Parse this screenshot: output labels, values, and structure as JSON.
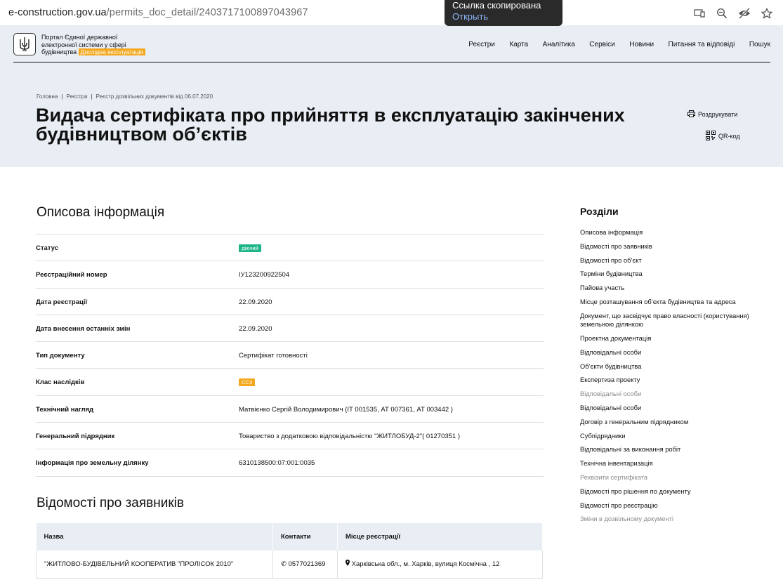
{
  "browser": {
    "url_domain": "e-construction.gov.ua",
    "url_path": "/permits_doc_detail/2403717100897043967",
    "toast_title": "Ссылка скопирована",
    "toast_action": "Открыть"
  },
  "header": {
    "logo_line1": "Портал Єдиної державної",
    "logo_line2": "електронної системи у сфері",
    "logo_line3": "будівництва",
    "logo_badge": "Дослідна експлуатація",
    "nav": [
      "Реєстри",
      "Карта",
      "Аналітика",
      "Сервіси",
      "Новини",
      "Питання та відповіді",
      "Пошук"
    ]
  },
  "breadcrumb": [
    "Головна",
    "Реєстри",
    "Реєстр дозвільних документів від 06.07.2020"
  ],
  "page_title": "Видача сертифіката про прийняття в експлуатацію закінчених будівництвом об’єктів",
  "actions": {
    "print": "Роздрукувати",
    "qr": "QR-код"
  },
  "section1_title": "Описова інформація",
  "info": [
    {
      "label": "Статус",
      "value": "діючий",
      "tag": "green"
    },
    {
      "label": "Реєстраційний номер",
      "value": "ІУ123200922504"
    },
    {
      "label": "Дата реєстрації",
      "value": "22.09.2020"
    },
    {
      "label": "Дата внесення останніх змін",
      "value": "22.09.2020"
    },
    {
      "label": "Тип документу",
      "value": "Сертифікат готовності"
    },
    {
      "label": "Клас наслідків",
      "value": "СС3",
      "tag": "orange"
    },
    {
      "label": "Технічний нагляд",
      "value": "Матвієнко Сергій Володимирович (ІТ 001535, АТ 007361, АТ 003442 )"
    },
    {
      "label": "Генеральний підрядник",
      "value": "Товариство з додатковою відповідальністю \"ЖИТЛОБУД-2\"( 01270351 )"
    },
    {
      "label": "Інформація про земельну ділянку",
      "value": "6310138500:07:001:0035"
    }
  ],
  "section2_title": "Відомості про заявників",
  "applicants": {
    "headers": [
      "Назва",
      "Контакти",
      "Місце реєстрації"
    ],
    "rows": [
      {
        "name": "\"ЖИТЛОВО-БУДІВЕЛЬНИЙ КООПЕРАТИВ \"ПРОЛІСОК 2010\"",
        "phone": "0577021369",
        "address": "Харківська обл., м. Харків, вулиця Космічна , 12"
      }
    ]
  },
  "sidebar": {
    "title": "Розділи",
    "items": [
      {
        "label": "Описова інформація",
        "muted": false
      },
      {
        "label": "Відомості про заявників",
        "muted": false
      },
      {
        "label": "Відомості про об’єкт",
        "muted": false
      },
      {
        "label": "Терміни будівництва",
        "muted": false
      },
      {
        "label": "Пайова участь",
        "muted": false
      },
      {
        "label": "Місце розташування об’єкта будівництва та адреса",
        "muted": false
      },
      {
        "label": "Документ, що засвідчує право власності (користування) земельною ділянкою",
        "muted": false
      },
      {
        "label": "Проектна документація",
        "muted": false
      },
      {
        "label": "Відповідальні особи",
        "muted": false
      },
      {
        "label": "Об’єкти будівництва",
        "muted": false
      },
      {
        "label": "Експертиза проекту",
        "muted": false
      },
      {
        "label": "Відповідальні особи",
        "muted": true
      },
      {
        "label": "Відповідальні особи",
        "muted": false
      },
      {
        "label": "Договір з генеральним підрядником",
        "muted": false
      },
      {
        "label": "Субпідрядники",
        "muted": false
      },
      {
        "label": "Відповідальні за виконання робіт",
        "muted": false
      },
      {
        "label": "Технічна інвентаризація",
        "muted": false
      },
      {
        "label": "Реквізити сертифіката",
        "muted": true
      },
      {
        "label": "Відомості про рішення по документу",
        "muted": false
      },
      {
        "label": "Відомості про реєстрацію",
        "muted": false
      },
      {
        "label": "Зміни в дозвільному документі",
        "muted": true
      }
    ]
  }
}
